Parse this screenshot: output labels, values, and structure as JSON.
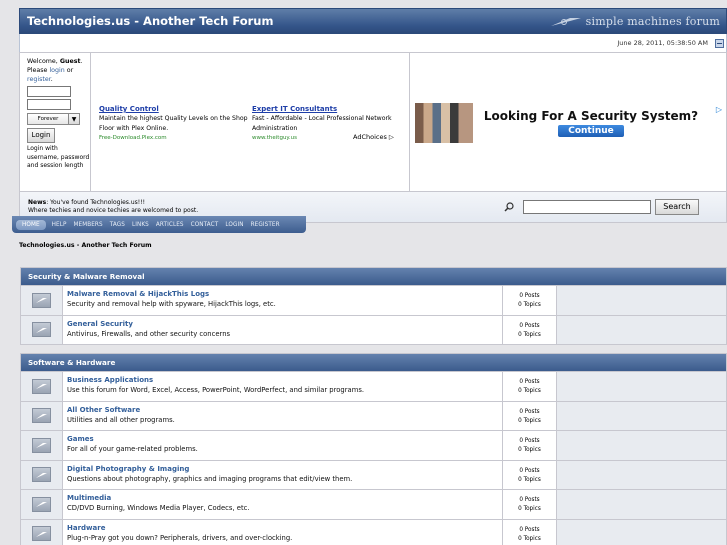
{
  "header": {
    "site_title": "Technologies.us - Another Tech Forum",
    "logo_text": "simple machines forum",
    "date": "June 28, 2011, 05:38:50 AM"
  },
  "user_panel": {
    "welcome_prefix": "Welcome, ",
    "guest": "Guest",
    "please": ". Please ",
    "login_link": "login",
    "or": " or",
    "register_link": "register",
    "duration": "Forever",
    "login_button": "Login",
    "login_note": "Login with username, password and session length"
  },
  "ads": {
    "unit1": {
      "title": "Quality Control",
      "text": "Maintain the highest Quality Levels on the Shop Floor with Plex Online.",
      "url": "Free-Download.Plex.com"
    },
    "unit2": {
      "title": "Expert IT Consultants",
      "text": "Fast - Affordable - Local Professional Network Administration",
      "url": "www.theitguy.us"
    },
    "adchoices": "AdChoices ▷",
    "banner_headline": "Looking For A Security System?",
    "banner_button": "Continue"
  },
  "news": {
    "label": "News",
    "line1": ": You've found Technologies.us!!!",
    "line2": "Where techies and novice techies are welcomed to post."
  },
  "search": {
    "button": "Search"
  },
  "nav": [
    "HOME",
    "HELP",
    "MEMBERS",
    "TAGS",
    "LINKS",
    "ARTICLES",
    "CONTACT",
    "LOGIN",
    "REGISTER"
  ],
  "breadcrumb": "Technologies.us - Another Tech Forum",
  "categories": [
    {
      "name": "Security & Malware Removal",
      "boards": [
        {
          "name": "Malware Removal & HijackThis Logs",
          "desc": "Security and removal help with spyware, HijackThis logs, etc.",
          "posts": "0 Posts",
          "topics": "0 Topics"
        },
        {
          "name": "General Security",
          "desc": "Antivirus, Firewalls, and other security concerns",
          "posts": "0 Posts",
          "topics": "0 Topics"
        }
      ]
    },
    {
      "name": "Software & Hardware",
      "boards": [
        {
          "name": "Business Applications",
          "desc": "Use this forum for Word, Excel, Access, PowerPoint, WordPerfect, and similar programs.",
          "posts": "0 Posts",
          "topics": "0 Topics"
        },
        {
          "name": "All Other Software",
          "desc": "Utilities and all other programs.",
          "posts": "0 Posts",
          "topics": "0 Topics"
        },
        {
          "name": "Games",
          "desc": "For all of your game-related problems.",
          "posts": "0 Posts",
          "topics": "0 Topics"
        },
        {
          "name": "Digital Photography & Imaging",
          "desc": "Questions about photography, graphics and imaging programs that edit/view them.",
          "posts": "0 Posts",
          "topics": "0 Topics"
        },
        {
          "name": "Multimedia",
          "desc": "CD/DVD Burning, Windows Media Player, Codecs, etc.",
          "posts": "0 Posts",
          "topics": "0 Topics"
        },
        {
          "name": "Hardware",
          "desc": "Plug-n-Pray got you down? Peripherals, drivers, and over-clocking.",
          "posts": "0 Posts",
          "topics": "0 Topics"
        }
      ]
    }
  ]
}
